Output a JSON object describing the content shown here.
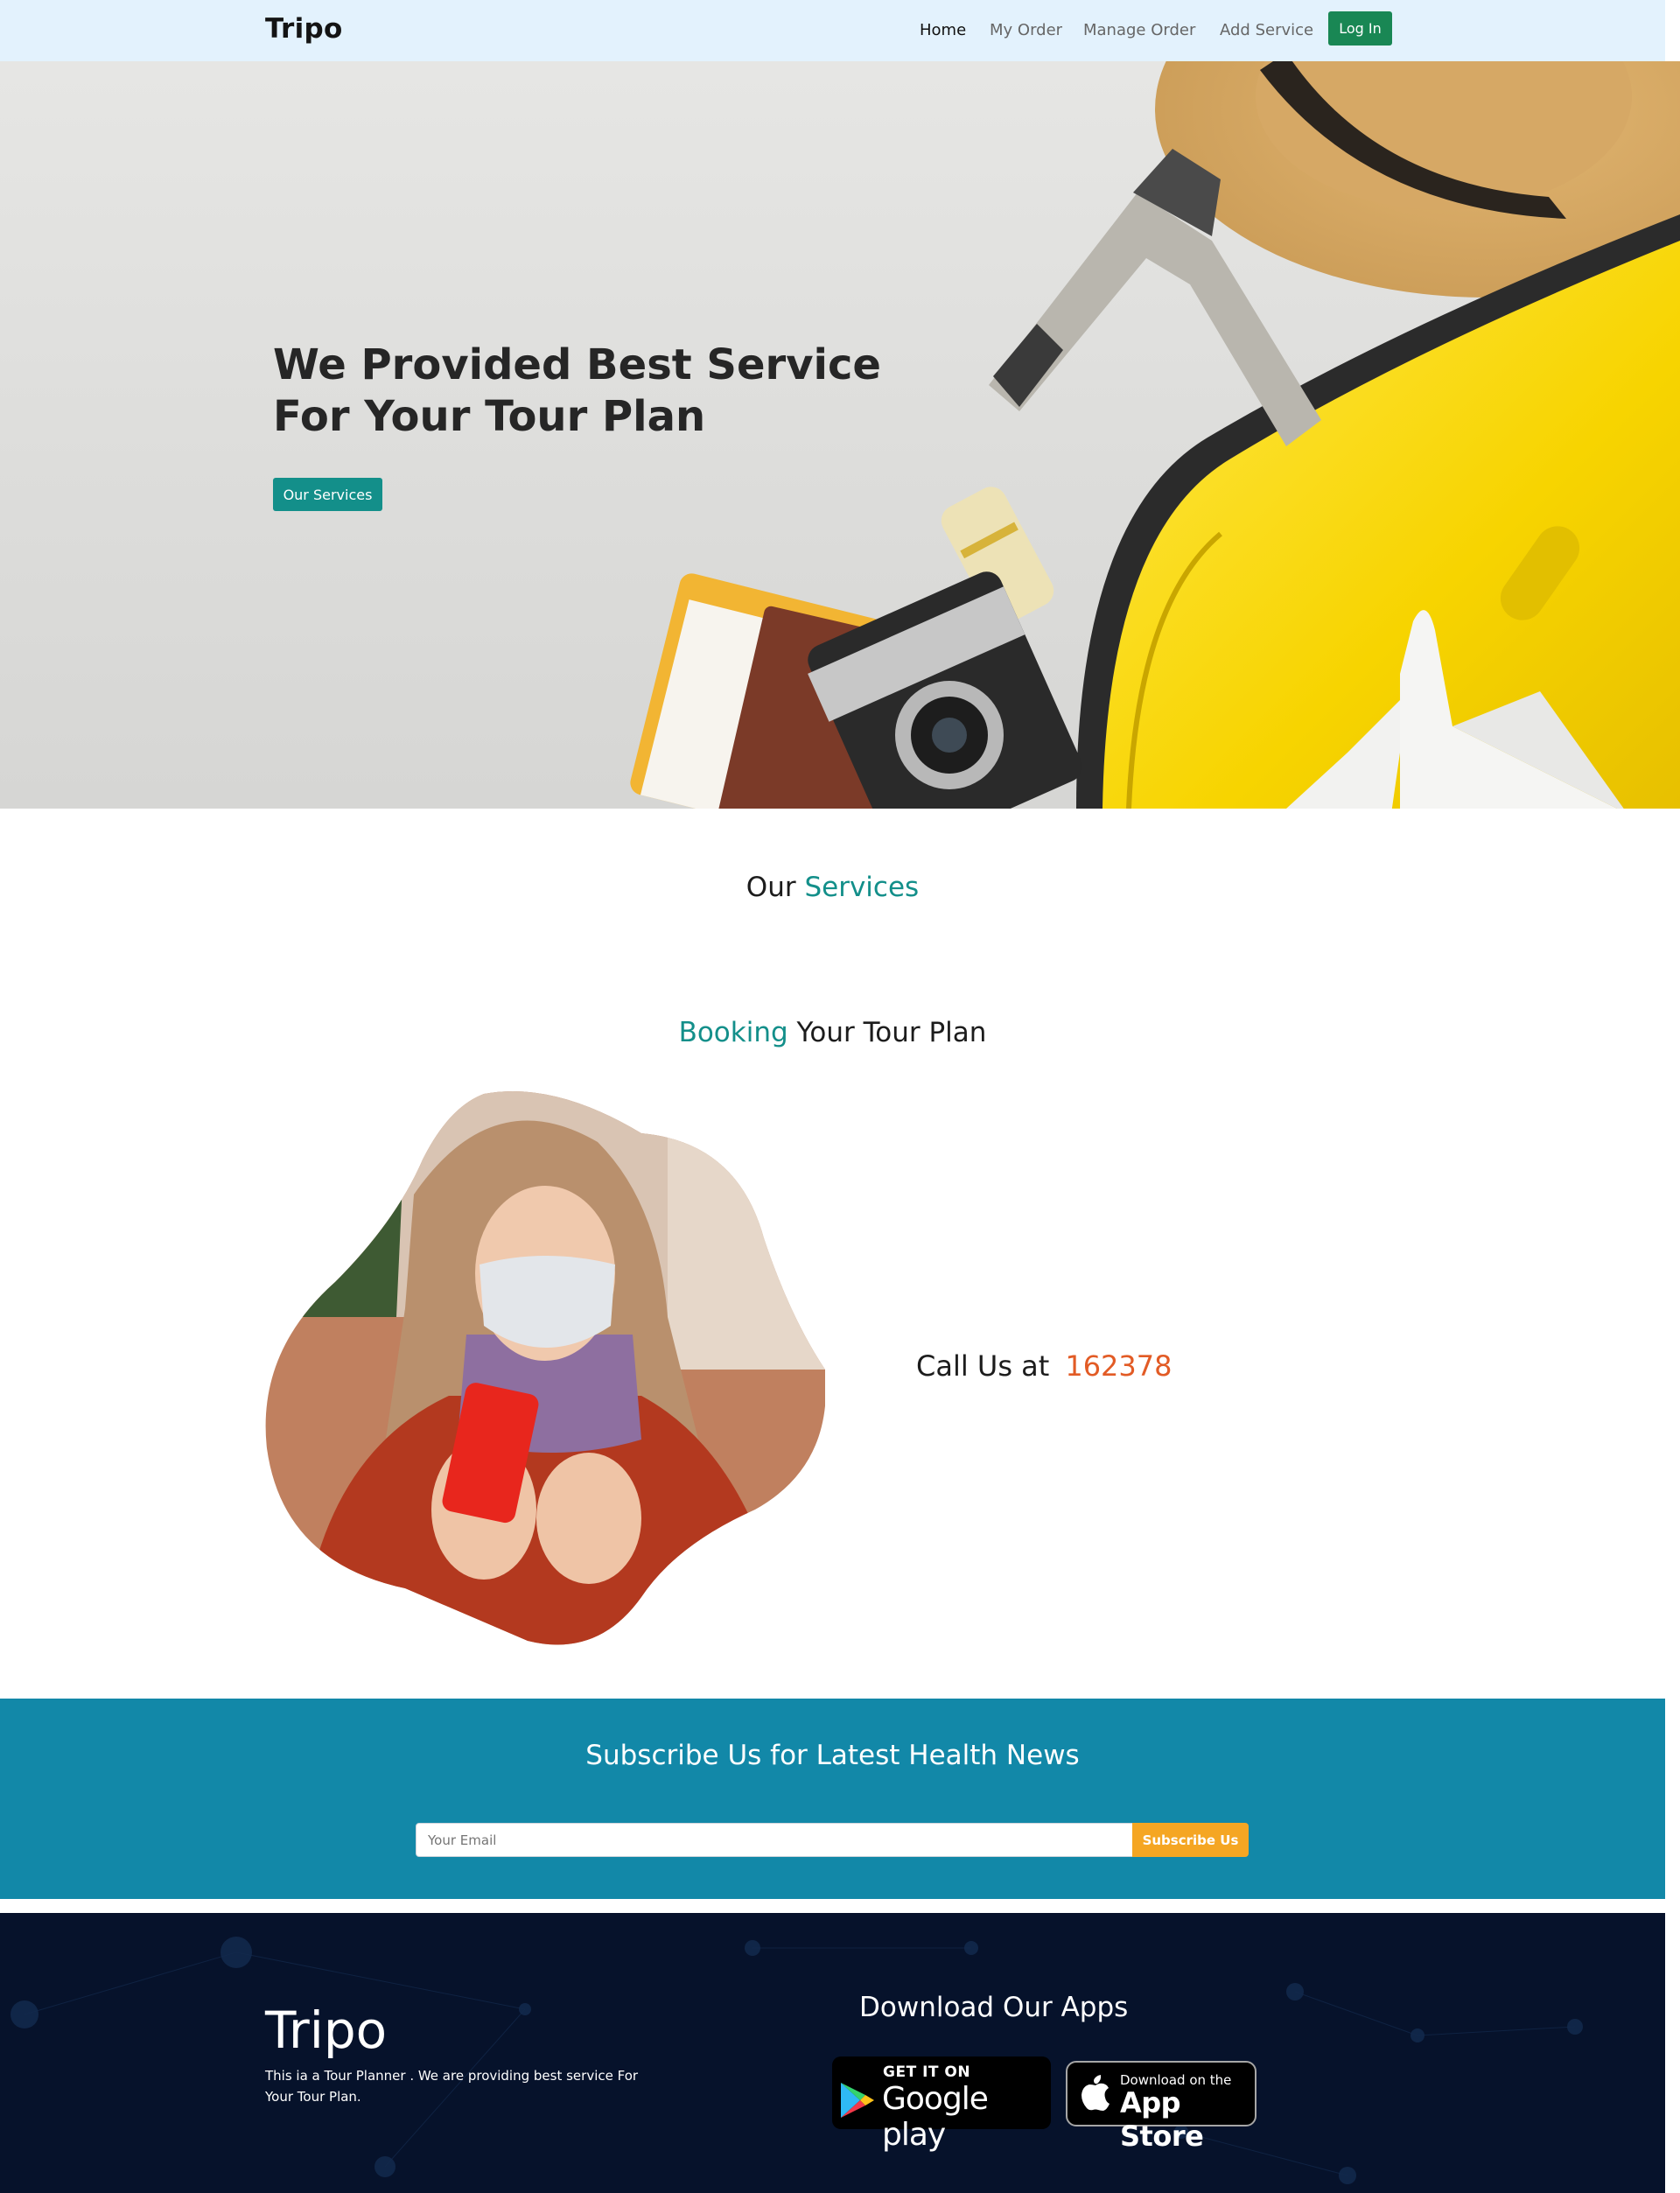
{
  "navbar": {
    "brand": "Tripo",
    "links": [
      {
        "label": "Home",
        "active": true
      },
      {
        "label": "My Order",
        "active": false
      },
      {
        "label": "Manage Order",
        "active": false
      },
      {
        "label": "Add Service",
        "active": false
      }
    ],
    "login_label": "Log In"
  },
  "hero": {
    "title_line1": "We Provided Best Service",
    "title_line2": "For Your Tour Plan",
    "button_label": "Our Services"
  },
  "services": {
    "heading_prefix": "Our",
    "heading_accent": "Services"
  },
  "booking": {
    "heading_accent": "Booking",
    "heading_rest": "Your Tour Plan",
    "call_label": "Call Us at",
    "call_number": "162378"
  },
  "subscribe": {
    "title": "Subscribe Us for Latest Health News",
    "email_placeholder": "Your Email",
    "button_label": "Subscribe Us"
  },
  "footer": {
    "brand": "Tripo",
    "description": "This ia a Tour Planner . We are providing best service For Your Tour Plan.",
    "apps_title": "Download Our Apps",
    "google_play": {
      "small": "GET IT ON",
      "big": "Google play"
    },
    "app_store": {
      "small": "Download on the",
      "big": "App Store"
    }
  },
  "colors": {
    "accent_teal": "#138f8a",
    "login_green": "#198754",
    "call_orange": "#e25b25",
    "subscribe_bg": "#1288a8",
    "subscribe_btn": "#f5a623",
    "footer_bg": "#06122b",
    "nav_bg": "#e3f2fd"
  }
}
